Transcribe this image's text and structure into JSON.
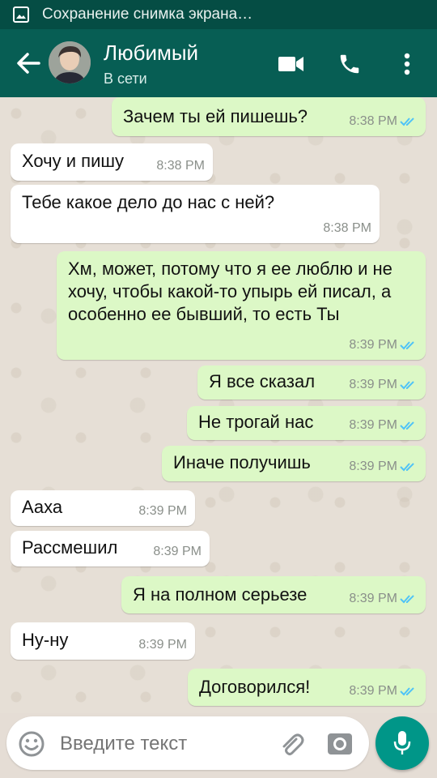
{
  "statusbar": {
    "text": "Сохранение снимка экрана…",
    "icon": "image-icon"
  },
  "header": {
    "name": "Любимый",
    "status": "В сети",
    "actions": [
      "video-call-icon",
      "phone-icon",
      "more-vert-icon"
    ]
  },
  "messages": [
    {
      "dir": "out",
      "text": "Зачем ты ей пишешь?",
      "time": "8:38 PM",
      "read": true
    },
    {
      "dir": "in",
      "text": "Хочу и пишу",
      "time": "8:38 PM"
    },
    {
      "dir": "in",
      "text": "Тебе какое дело до нас с ней?",
      "time": "8:38 PM"
    },
    {
      "dir": "out",
      "text": "Хм, может, потому что я ее люблю и не хочу, чтобы какой-то упырь ей писал, а особенно ее бывший, то есть Ты",
      "time": "8:39 PM",
      "read": true
    },
    {
      "dir": "out",
      "text": "Я все сказал",
      "time": "8:39 PM",
      "read": true
    },
    {
      "dir": "out",
      "text": "Не трогай нас",
      "time": "8:39 PM",
      "read": true
    },
    {
      "dir": "out",
      "text": "Иначе получишь",
      "time": "8:39 PM",
      "read": true
    },
    {
      "dir": "in",
      "text": "Ааха",
      "time": "8:39 PM"
    },
    {
      "dir": "in",
      "text": "Рассмешил",
      "time": "8:39 PM"
    },
    {
      "dir": "out",
      "text": "Я на полном серьезе",
      "time": "8:39 PM",
      "read": true
    },
    {
      "dir": "in",
      "text": "Ну-ну",
      "time": "8:39 PM"
    },
    {
      "dir": "out",
      "text": "Договорился!",
      "time": "8:39 PM",
      "read": true
    }
  ],
  "input": {
    "placeholder": "Введите текст"
  },
  "colors": {
    "header": "#075e54",
    "statusbar": "#054d44",
    "outgoing": "#dcf8c6",
    "incoming": "#ffffff",
    "read_ticks": "#4fc3f7",
    "fab": "#009688"
  }
}
